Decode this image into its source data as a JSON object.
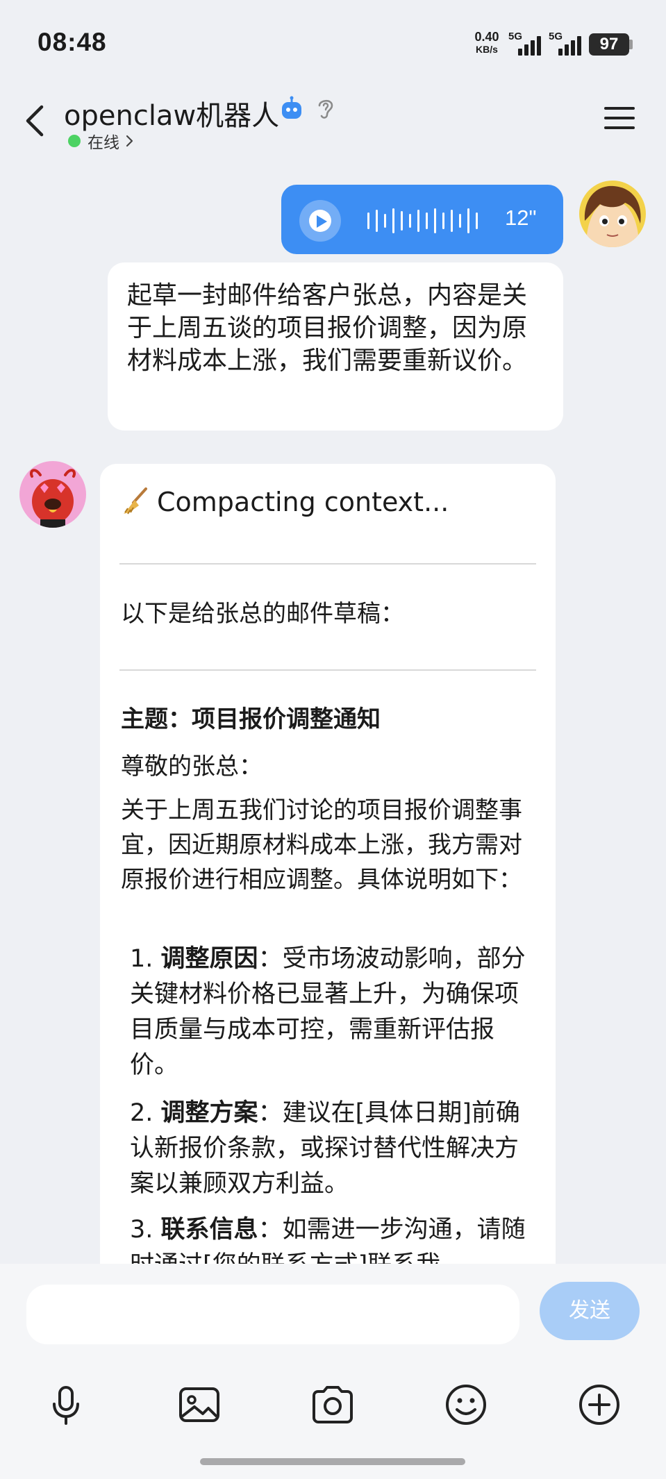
{
  "status_bar": {
    "time": "08:48",
    "net_speed_value": "0.40",
    "net_speed_unit": "KB/s",
    "sim1_label": "5G",
    "sim2_label": "5G",
    "battery": "97"
  },
  "header": {
    "title": "openclaw机器人",
    "status": "在线",
    "status_color": "#4cd263",
    "icons": [
      "back-arrow-icon",
      "robot-icon",
      "ear-icon",
      "chevron-right-icon",
      "menu-icon"
    ]
  },
  "messages": {
    "voice": {
      "duration": "12\"",
      "bubble_color": "#3d8ef3",
      "icon": "play-icon"
    },
    "transcript": "起草一封邮件给客户张总，内容是关于上周五谈的项目报价调整，因为原材料成本上涨，我们需要重新议价。",
    "bot": {
      "compacting_icon": "broom-icon",
      "compacting": "Compacting context...",
      "intro": "以下是给张总的邮件草稿：",
      "subject": "主题：项目报价调整通知",
      "greeting": "尊敬的张总：",
      "body": "关于上周五我们讨论的项目报价调整事宜，因近期原材料成本上涨，我方需对原报价进行相应调整。具体说明如下：",
      "items": [
        {
          "num": "1.",
          "head": "调整原因",
          "text": "：受市场波动影响，部分关键材料价格已显著上升，为确保项目质量与成本可控，需重新评估报价。"
        },
        {
          "num": "2.",
          "head": "调整方案",
          "text": "：建议在[具体日期]前确认新报价条款，或探讨替代性解决方案以兼顾双方利益。"
        },
        {
          "num": "3.",
          "head": "联系信息",
          "text": "：如需进一步沟通，请随时通过[您的联系方式]联系我。"
        }
      ]
    }
  },
  "input_bar": {
    "placeholder": "",
    "send_label": "发送",
    "send_color": "#a9cdf7",
    "tools": [
      "microphone-icon",
      "image-icon",
      "camera-icon",
      "emoji-icon",
      "plus-icon"
    ]
  }
}
